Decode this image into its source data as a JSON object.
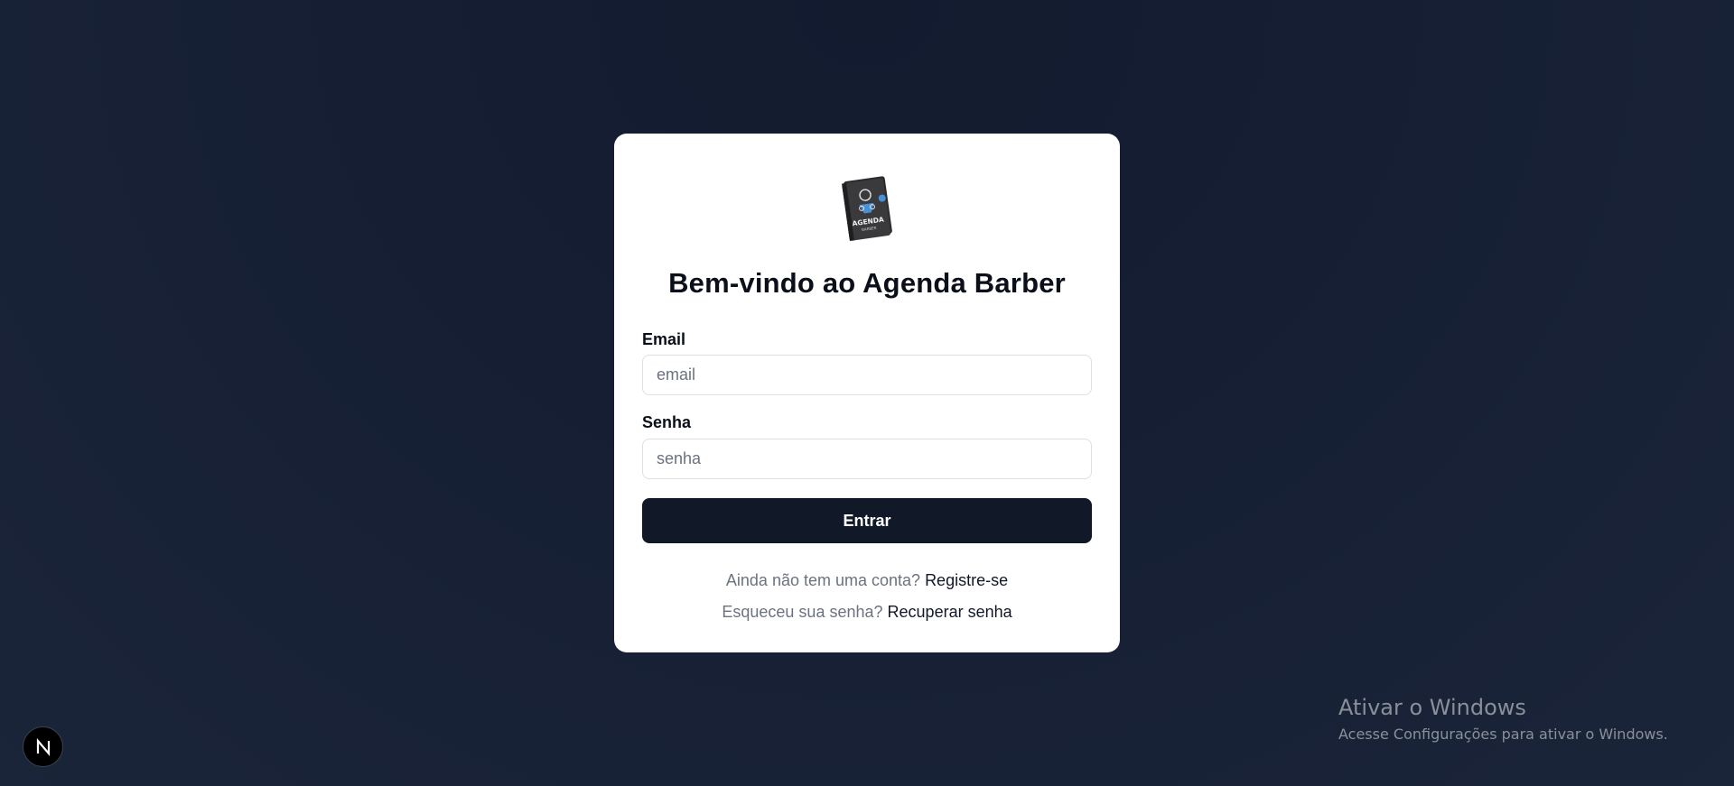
{
  "login": {
    "logo_text": "AGENDA",
    "logo_subtext": "BARBER",
    "title": "Bem-vindo ao Agenda Barber",
    "email_label": "Email",
    "email_placeholder": "email",
    "email_value": "",
    "password_label": "Senha",
    "password_placeholder": "senha",
    "password_value": "",
    "submit_label": "Entrar",
    "register_prompt": "Ainda não tem uma conta?",
    "register_link": "Registre-se",
    "forgot_prompt": "Esqueceu sua senha?",
    "forgot_link": "Recuperar senha"
  },
  "next_badge": {
    "letter": "N",
    "icon": "nextjs-icon"
  },
  "windows_watermark": {
    "title": "Ativar o Windows",
    "subtitle": "Acesse Configurações para ativar o Windows."
  },
  "colors": {
    "background": "#151e33",
    "card": "#ffffff",
    "button": "#111827",
    "muted_text": "#6b7280"
  }
}
